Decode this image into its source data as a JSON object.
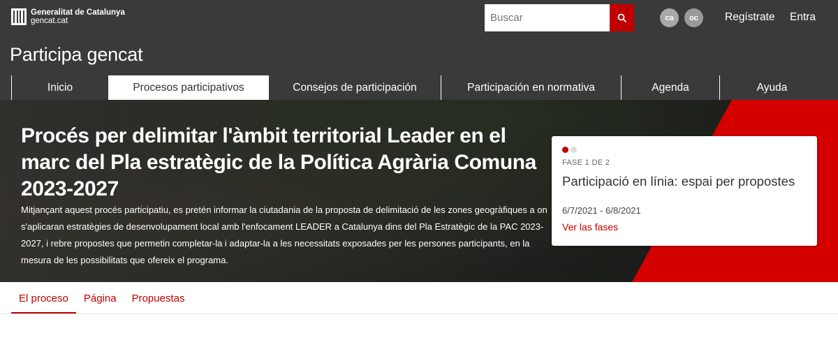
{
  "header": {
    "logo_line1": "Generalitat de Catalunya",
    "logo_line2": "gencat.cat",
    "search_placeholder": "Buscar",
    "languages": [
      "ca",
      "oc"
    ],
    "register_label": "Regístrate",
    "login_label": "Entra",
    "site_title": "Participa gencat"
  },
  "nav": {
    "items": [
      {
        "label": "Inicio",
        "active": false
      },
      {
        "label": "Procesos participativos",
        "active": true
      },
      {
        "label": "Consejos de participación",
        "active": false
      },
      {
        "label": "Participación en normativa",
        "active": false
      },
      {
        "label": "Agenda",
        "active": false
      },
      {
        "label": "Ayuda",
        "active": false
      }
    ]
  },
  "hero": {
    "title": "Procés per delimitar l'àmbit territorial Leader en el marc del Pla estratègic de la Política Agrària Comuna 2023-2027",
    "description": "Mitjançant aquest procés participatiu, es pretén informar la ciutadania de la proposta de delimitació de les zones geogràfiques a on s'aplicaran estratègies de desenvolupament local amb l'enfocament LEADER a Catalunya dins del Pla Estratègic de la PAC 2023-2027, i rebre propostes que permetin completar-la i adaptar-la a les necessitats exposades per les persones participants, en la mesura de les possibilitats que ofereix el programa."
  },
  "phase": {
    "label": "FASE 1 DE 2",
    "name": "Participació en línia: espai per propostes",
    "dates": "6/7/2021 - 6/8/2021",
    "link_label": "Ver las fases",
    "current": 1,
    "total": 2
  },
  "tabs": {
    "items": [
      {
        "label": "El proceso",
        "active": true
      },
      {
        "label": "Página",
        "active": false
      },
      {
        "label": "Propuestas",
        "active": false
      }
    ]
  },
  "colors": {
    "header_bg": "#3a3a3a",
    "accent": "#c00000"
  }
}
